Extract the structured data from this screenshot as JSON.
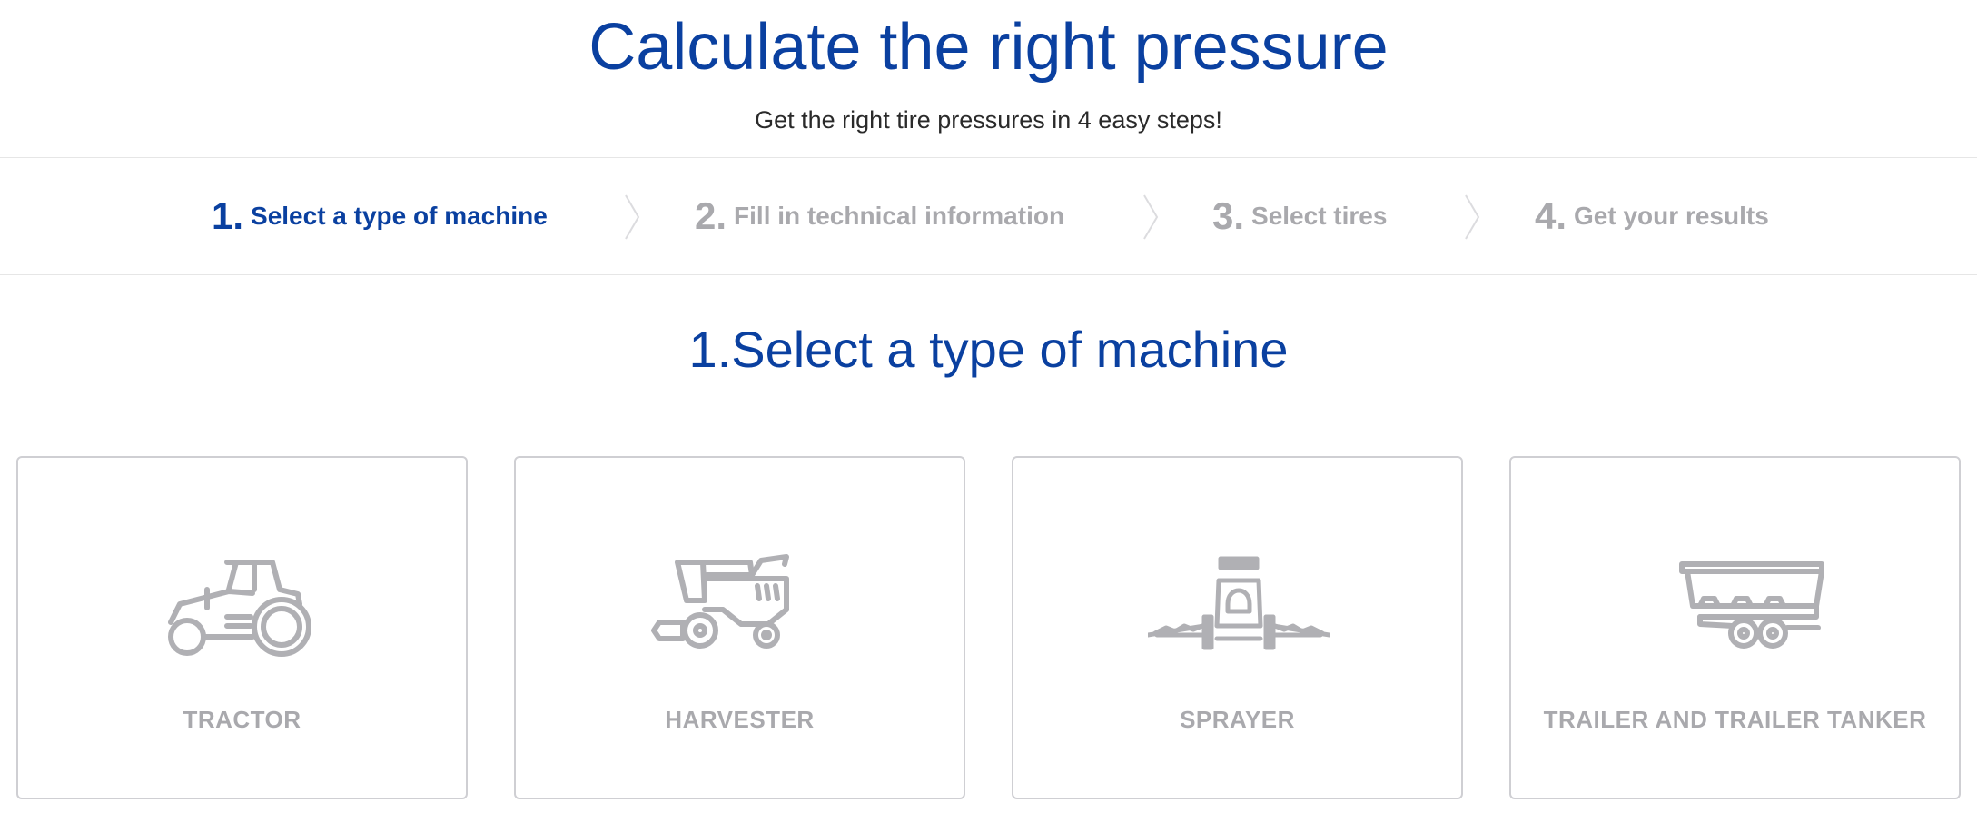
{
  "header": {
    "title": "Calculate the right pressure",
    "subtitle": "Get the right tire pressures in 4 easy steps!"
  },
  "steps": [
    {
      "number": "1.",
      "label": "Select a type of machine",
      "active": true
    },
    {
      "number": "2.",
      "label": "Fill in technical information",
      "active": false
    },
    {
      "number": "3.",
      "label": "Select tires",
      "active": false
    },
    {
      "number": "4.",
      "label": "Get your results",
      "active": false
    }
  ],
  "section": {
    "title": "1.Select a type of machine"
  },
  "machines": [
    {
      "label": "TRACTOR",
      "icon": "tractor-icon"
    },
    {
      "label": "HARVESTER",
      "icon": "harvester-icon"
    },
    {
      "label": "SPRAYER",
      "icon": "sprayer-icon"
    },
    {
      "label": "TRAILER AND TRAILER TANKER",
      "icon": "trailer-icon"
    }
  ],
  "colors": {
    "accent": "#0a40a0",
    "inactive": "#a9a9ad",
    "border": "#cfcfd3",
    "text": "#2a2a2a"
  }
}
